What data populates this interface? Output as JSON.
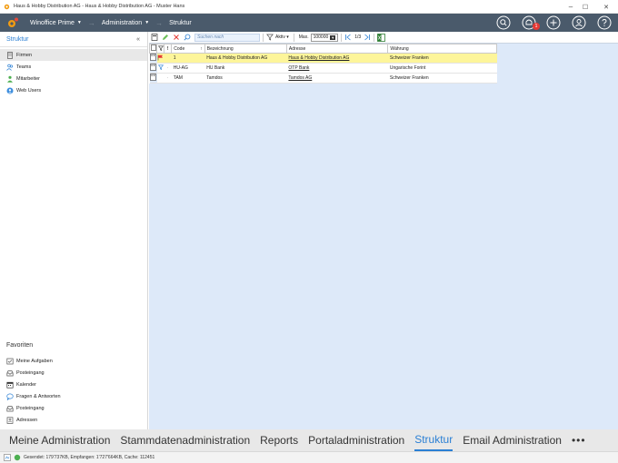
{
  "window": {
    "title": "Haus & Hobby Distribution AG - Haus & Hobby Distribution AG - Muster Hans",
    "minimize": "–",
    "maximize": "☐",
    "close": "✕"
  },
  "topnav": {
    "app_label": "Winoffice Prime",
    "section_label": "Administration",
    "page_label": "Struktur",
    "notification_count": "1"
  },
  "sidebar": {
    "title": "Struktur",
    "collapse_glyph": "«",
    "items": [
      {
        "label": "Firmen",
        "icon": "company-icon"
      },
      {
        "label": "Teams",
        "icon": "team-icon"
      },
      {
        "label": "Mitarbeiter",
        "icon": "employee-icon"
      },
      {
        "label": "Web Users",
        "icon": "web-user-icon"
      }
    ],
    "favorites_title": "Favoriten",
    "favorites": [
      {
        "label": "Meine Aufgaben",
        "icon": "tasks-icon"
      },
      {
        "label": "Posteingang",
        "icon": "inbox-icon"
      },
      {
        "label": "Kalender",
        "icon": "calendar-icon"
      },
      {
        "label": "Fragen & Antworten",
        "icon": "qa-icon"
      },
      {
        "label": "Posteingang",
        "icon": "inbox-icon"
      },
      {
        "label": "Adressen",
        "icon": "address-icon"
      }
    ]
  },
  "toolbar": {
    "search_placeholder": "Suchen nach",
    "filter_label": "Aktiv",
    "max_label": "Max.",
    "max_value": "100000",
    "pager": "1/3"
  },
  "grid": {
    "columns": [
      "Code",
      "Bezeichnung",
      "Adresse",
      "Währung"
    ],
    "sort_glyph": "↑",
    "rows": [
      {
        "code": "1",
        "bezeichnung": "Haus & Hobby Distribution AG",
        "adresse": "Haus & Hobby Distribution AG",
        "waehrung": "Schweizer Franken"
      },
      {
        "code": "HU-AG",
        "bezeichnung": "HU Bank",
        "adresse": "OTP Bank",
        "waehrung": "Ungarische Forint"
      },
      {
        "code": "TAM",
        "bezeichnung": "Tamdos",
        "adresse": "Tamdos AG",
        "waehrung": "Schweizer Franken"
      }
    ]
  },
  "bottom_tabs": {
    "tabs": [
      "Meine Administration",
      "Stammdatenadministration",
      "Reports",
      "Portaladministration",
      "Struktur",
      "Email Administration"
    ],
    "more": "•••"
  },
  "status": {
    "text": "Gesendet: 179'737KB, Empfangen: 1'727'664KB, Cache: 112451"
  },
  "colors": {
    "nav_bg": "#4a5a6b",
    "accent": "#2a7fd4",
    "main_bg": "#dde9f9",
    "selected_row": "#fdf59a",
    "badge": "#e53935"
  }
}
